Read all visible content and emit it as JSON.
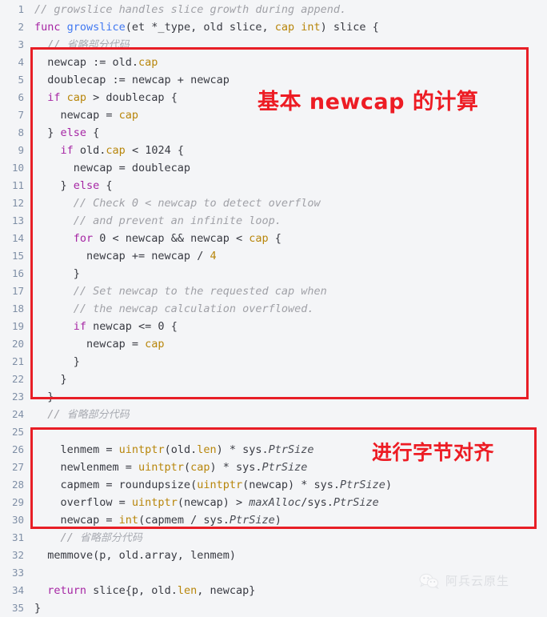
{
  "editor": {
    "language": "go",
    "background_color": "#f4f5f7",
    "gutter_color": "#7f8fa6",
    "first_line": 1,
    "last_line": 35,
    "line_numbers": [
      "1",
      "2",
      "3",
      "4",
      "5",
      "6",
      "7",
      "8",
      "9",
      "10",
      "11",
      "12",
      "13",
      "14",
      "15",
      "16",
      "17",
      "18",
      "19",
      "20",
      "21",
      "22",
      "23",
      "24",
      "25",
      "26",
      "27",
      "28",
      "29",
      "30",
      "31",
      "32",
      "33",
      "34",
      "35"
    ],
    "lines": [
      {
        "n": "1",
        "tokens": [
          {
            "t": "// growslice handles slice growth during append.",
            "c": "cm"
          }
        ]
      },
      {
        "n": "2",
        "tokens": [
          {
            "t": "func ",
            "c": "kw"
          },
          {
            "t": "growslice",
            "c": "fn"
          },
          {
            "t": "(et *_type, old slice, ",
            "c": "pl"
          },
          {
            "t": "cap int",
            "c": "id"
          },
          {
            "t": ") slice {",
            "c": "pl"
          }
        ]
      },
      {
        "n": "3",
        "tokens": [
          {
            "t": "  // ",
            "c": "cm"
          },
          {
            "t": "省略部分代码",
            "c": "cmzh"
          }
        ]
      },
      {
        "n": "4",
        "tokens": [
          {
            "t": "  newcap := old.",
            "c": "pl"
          },
          {
            "t": "cap",
            "c": "id"
          }
        ]
      },
      {
        "n": "5",
        "tokens": [
          {
            "t": "  doublecap := newcap + newcap",
            "c": "pl"
          }
        ]
      },
      {
        "n": "6",
        "tokens": [
          {
            "t": "  if ",
            "c": "kw"
          },
          {
            "t": "cap",
            "c": "id"
          },
          {
            "t": " > doublecap {",
            "c": "pl"
          }
        ]
      },
      {
        "n": "7",
        "tokens": [
          {
            "t": "    newcap = ",
            "c": "pl"
          },
          {
            "t": "cap",
            "c": "id"
          }
        ]
      },
      {
        "n": "8",
        "tokens": [
          {
            "t": "  } ",
            "c": "pl"
          },
          {
            "t": "else",
            "c": "kw"
          },
          {
            "t": " {",
            "c": "pl"
          }
        ]
      },
      {
        "n": "9",
        "tokens": [
          {
            "t": "    if",
            "c": "kw"
          },
          {
            "t": " old.",
            "c": "pl"
          },
          {
            "t": "cap",
            "c": "id"
          },
          {
            "t": " < 1024 {",
            "c": "pl"
          }
        ]
      },
      {
        "n": "10",
        "tokens": [
          {
            "t": "      newcap = doublecap",
            "c": "pl"
          }
        ]
      },
      {
        "n": "11",
        "tokens": [
          {
            "t": "    } ",
            "c": "pl"
          },
          {
            "t": "else",
            "c": "kw"
          },
          {
            "t": " {",
            "c": "pl"
          }
        ]
      },
      {
        "n": "12",
        "tokens": [
          {
            "t": "      // Check 0 < newcap to detect overflow",
            "c": "cm"
          }
        ]
      },
      {
        "n": "13",
        "tokens": [
          {
            "t": "      // and prevent an infinite loop.",
            "c": "cm"
          }
        ]
      },
      {
        "n": "14",
        "tokens": [
          {
            "t": "      for",
            "c": "kw"
          },
          {
            "t": " 0 < newcap && newcap < ",
            "c": "pl"
          },
          {
            "t": "cap",
            "c": "id"
          },
          {
            "t": " {",
            "c": "pl"
          }
        ]
      },
      {
        "n": "15",
        "tokens": [
          {
            "t": "        newcap += newcap / ",
            "c": "pl"
          },
          {
            "t": "4",
            "c": "id"
          }
        ]
      },
      {
        "n": "16",
        "tokens": [
          {
            "t": "      }",
            "c": "pl"
          }
        ]
      },
      {
        "n": "17",
        "tokens": [
          {
            "t": "      // Set newcap to the requested cap when",
            "c": "cm"
          }
        ]
      },
      {
        "n": "18",
        "tokens": [
          {
            "t": "      // the newcap calculation overflowed.",
            "c": "cm"
          }
        ]
      },
      {
        "n": "19",
        "tokens": [
          {
            "t": "      if",
            "c": "kw"
          },
          {
            "t": " newcap <= 0 {",
            "c": "pl"
          }
        ]
      },
      {
        "n": "20",
        "tokens": [
          {
            "t": "        newcap = ",
            "c": "pl"
          },
          {
            "t": "cap",
            "c": "id"
          }
        ]
      },
      {
        "n": "21",
        "tokens": [
          {
            "t": "      }",
            "c": "pl"
          }
        ]
      },
      {
        "n": "22",
        "tokens": [
          {
            "t": "    }",
            "c": "pl"
          }
        ]
      },
      {
        "n": "23",
        "tokens": [
          {
            "t": "  }",
            "c": "pl"
          }
        ]
      },
      {
        "n": "24",
        "tokens": [
          {
            "t": "  // ",
            "c": "cm"
          },
          {
            "t": "省略部分代码",
            "c": "cmzh"
          }
        ]
      },
      {
        "n": "25",
        "tokens": [
          {
            "t": "",
            "c": "pl"
          }
        ]
      },
      {
        "n": "26",
        "tokens": [
          {
            "t": "    lenmem = ",
            "c": "pl"
          },
          {
            "t": "uintptr",
            "c": "id"
          },
          {
            "t": "(old.",
            "c": "pl"
          },
          {
            "t": "len",
            "c": "id"
          },
          {
            "t": ") * sys.",
            "c": "pl"
          },
          {
            "t": "PtrSize",
            "c": "it"
          }
        ]
      },
      {
        "n": "27",
        "tokens": [
          {
            "t": "    newlenmem = ",
            "c": "pl"
          },
          {
            "t": "uintptr",
            "c": "id"
          },
          {
            "t": "(",
            "c": "pl"
          },
          {
            "t": "cap",
            "c": "id"
          },
          {
            "t": ") * sys.",
            "c": "pl"
          },
          {
            "t": "PtrSize",
            "c": "it"
          }
        ]
      },
      {
        "n": "28",
        "tokens": [
          {
            "t": "    capmem = roundupsize(",
            "c": "pl"
          },
          {
            "t": "uintptr",
            "c": "id"
          },
          {
            "t": "(newcap) * sys.",
            "c": "pl"
          },
          {
            "t": "PtrSize",
            "c": "it"
          },
          {
            "t": ")",
            "c": "pl"
          }
        ]
      },
      {
        "n": "29",
        "tokens": [
          {
            "t": "    overflow = ",
            "c": "pl"
          },
          {
            "t": "uintptr",
            "c": "id"
          },
          {
            "t": "(newcap) > ",
            "c": "pl"
          },
          {
            "t": "maxAlloc",
            "c": "it"
          },
          {
            "t": "/sys.",
            "c": "pl"
          },
          {
            "t": "PtrSize",
            "c": "it"
          }
        ]
      },
      {
        "n": "30",
        "tokens": [
          {
            "t": "    newcap = ",
            "c": "pl"
          },
          {
            "t": "int",
            "c": "id"
          },
          {
            "t": "(capmem / sys.",
            "c": "pl"
          },
          {
            "t": "PtrSize",
            "c": "it"
          },
          {
            "t": ")",
            "c": "pl"
          }
        ]
      },
      {
        "n": "31",
        "tokens": [
          {
            "t": "    // ",
            "c": "cm"
          },
          {
            "t": "省略部分代码",
            "c": "cmzh"
          }
        ]
      },
      {
        "n": "32",
        "tokens": [
          {
            "t": "  memmove(p, old.array, lenmem)",
            "c": "pl"
          }
        ]
      },
      {
        "n": "33",
        "tokens": [
          {
            "t": "",
            "c": "pl"
          }
        ]
      },
      {
        "n": "34",
        "tokens": [
          {
            "t": "  return",
            "c": "kw"
          },
          {
            "t": " slice{p, old.",
            "c": "pl"
          },
          {
            "t": "len",
            "c": "id"
          },
          {
            "t": ", newcap}",
            "c": "pl"
          }
        ]
      },
      {
        "n": "35",
        "tokens": [
          {
            "t": "}",
            "c": "pl"
          }
        ]
      }
    ]
  },
  "annotations": {
    "color": "#ed1c24",
    "boxes": [
      {
        "name": "newcap-calculation-box",
        "covers_lines": "4-23"
      },
      {
        "name": "byte-alignment-box",
        "covers_lines": "25-30"
      }
    ],
    "labels": [
      {
        "text": "基本 newcap 的计算"
      },
      {
        "text": "进行字节对齐"
      }
    ]
  },
  "watermark": {
    "icon": "wechat-icon",
    "text": "阿兵云原生"
  }
}
